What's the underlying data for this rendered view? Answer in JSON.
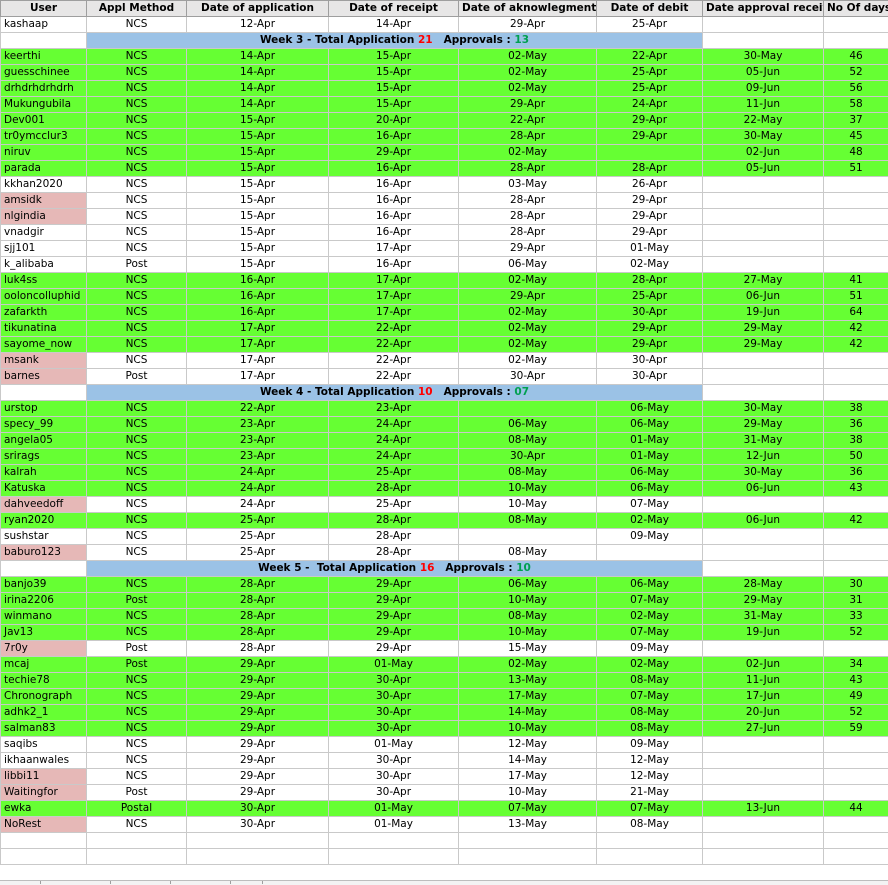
{
  "headers": [
    "User",
    "Appl Method",
    "Date of application",
    "Date of receipt",
    "Date of aknowlegment",
    "Date of debit",
    "Date approval received",
    "No Of days"
  ],
  "rows": [
    {
      "type": "row",
      "color": "white",
      "pink": false,
      "cells": [
        "kashaap",
        "NCS",
        "12-Apr",
        "14-Apr",
        "29-Apr",
        "25-Apr",
        "",
        ""
      ]
    },
    {
      "type": "week",
      "week": "Week 3 - Total Application ",
      "total": "21",
      "approvals_label": "   Approvals : ",
      "approvals": "13"
    },
    {
      "type": "row",
      "color": "green",
      "pink": false,
      "cells": [
        "keerthi",
        "NCS",
        "14-Apr",
        "15-Apr",
        "02-May",
        "22-Apr",
        "30-May",
        "46"
      ]
    },
    {
      "type": "row",
      "color": "green",
      "pink": false,
      "cells": [
        "guesschinee",
        "NCS",
        "14-Apr",
        "15-Apr",
        "02-May",
        "25-Apr",
        "05-Jun",
        "52"
      ]
    },
    {
      "type": "row",
      "color": "green",
      "pink": false,
      "cells": [
        "drhdrhdrhdrh",
        "NCS",
        "14-Apr",
        "15-Apr",
        "02-May",
        "25-Apr",
        "09-Jun",
        "56"
      ]
    },
    {
      "type": "row",
      "color": "green",
      "pink": false,
      "cells": [
        "Mukungubila",
        "NCS",
        "14-Apr",
        "15-Apr",
        "29-Apr",
        "24-Apr",
        "11-Jun",
        "58"
      ]
    },
    {
      "type": "row",
      "color": "green",
      "pink": false,
      "cells": [
        "Dev001",
        "NCS",
        "15-Apr",
        "20-Apr",
        "22-Apr",
        "29-Apr",
        "22-May",
        "37"
      ]
    },
    {
      "type": "row",
      "color": "green",
      "pink": false,
      "cells": [
        "tr0ymcclur3",
        "NCS",
        "15-Apr",
        "16-Apr",
        "28-Apr",
        "29-Apr",
        "30-May",
        "45"
      ]
    },
    {
      "type": "row",
      "color": "green",
      "pink": false,
      "cells": [
        "niruv",
        "NCS",
        "15-Apr",
        "29-Apr",
        "02-May",
        "",
        "02-Jun",
        "48"
      ]
    },
    {
      "type": "row",
      "color": "green",
      "pink": false,
      "cells": [
        "parada",
        "NCS",
        "15-Apr",
        "16-Apr",
        "28-Apr",
        "28-Apr",
        "05-Jun",
        "51"
      ]
    },
    {
      "type": "row",
      "color": "white",
      "pink": false,
      "cells": [
        "kkhan2020",
        "NCS",
        "15-Apr",
        "16-Apr",
        "03-May",
        "26-Apr",
        "",
        ""
      ]
    },
    {
      "type": "row",
      "color": "white",
      "pink": true,
      "cells": [
        "amsidk",
        "NCS",
        "15-Apr",
        "16-Apr",
        "28-Apr",
        "29-Apr",
        "",
        ""
      ]
    },
    {
      "type": "row",
      "color": "white",
      "pink": true,
      "cells": [
        "nlgindia",
        "NCS",
        "15-Apr",
        "16-Apr",
        "28-Apr",
        "29-Apr",
        "",
        ""
      ]
    },
    {
      "type": "row",
      "color": "white",
      "pink": false,
      "cells": [
        "vnadgir",
        "NCS",
        "15-Apr",
        "16-Apr",
        "28-Apr",
        "29-Apr",
        "",
        ""
      ]
    },
    {
      "type": "row",
      "color": "white",
      "pink": false,
      "cells": [
        "sjj101",
        "NCS",
        "15-Apr",
        "17-Apr",
        "29-Apr",
        "01-May",
        "",
        ""
      ]
    },
    {
      "type": "row",
      "color": "white",
      "pink": false,
      "cells": [
        "k_alibaba",
        "Post",
        "15-Apr",
        "16-Apr",
        "06-May",
        "02-May",
        "",
        ""
      ]
    },
    {
      "type": "row",
      "color": "green",
      "pink": false,
      "cells": [
        "luk4ss",
        "NCS",
        "16-Apr",
        "17-Apr",
        "02-May",
        "28-Apr",
        "27-May",
        "41"
      ]
    },
    {
      "type": "row",
      "color": "green",
      "pink": false,
      "cells": [
        "ooloncolluphid",
        "NCS",
        "16-Apr",
        "17-Apr",
        "29-Apr",
        "25-Apr",
        "06-Jun",
        "51"
      ]
    },
    {
      "type": "row",
      "color": "green",
      "pink": false,
      "cells": [
        "zafarkth",
        "NCS",
        "16-Apr",
        "17-Apr",
        "02-May",
        "30-Apr",
        "19-Jun",
        "64"
      ]
    },
    {
      "type": "row",
      "color": "green",
      "pink": false,
      "cells": [
        "tikunatina",
        "NCS",
        "17-Apr",
        "22-Apr",
        "02-May",
        "29-Apr",
        "29-May",
        "42"
      ]
    },
    {
      "type": "row",
      "color": "green",
      "pink": false,
      "cells": [
        "sayome_now",
        "NCS",
        "17-Apr",
        "22-Apr",
        "02-May",
        "29-Apr",
        "29-May",
        "42"
      ]
    },
    {
      "type": "row",
      "color": "white",
      "pink": true,
      "cells": [
        "msank",
        "NCS",
        "17-Apr",
        "22-Apr",
        "02-May",
        "30-Apr",
        "",
        ""
      ]
    },
    {
      "type": "row",
      "color": "white",
      "pink": true,
      "cells": [
        "barnes",
        "Post",
        "17-Apr",
        "22-Apr",
        "30-Apr",
        "30-Apr",
        "",
        ""
      ]
    },
    {
      "type": "week",
      "week": "Week 4 - Total Application ",
      "total": "10",
      "approvals_label": "   Approvals : ",
      "approvals": "07"
    },
    {
      "type": "row",
      "color": "green",
      "pink": false,
      "cells": [
        "urstop",
        "NCS",
        "22-Apr",
        "23-Apr",
        "",
        "06-May",
        "30-May",
        "38"
      ]
    },
    {
      "type": "row",
      "color": "green",
      "pink": false,
      "cells": [
        "specy_99",
        "NCS",
        "23-Apr",
        "24-Apr",
        "06-May",
        "06-May",
        "29-May",
        "36"
      ]
    },
    {
      "type": "row",
      "color": "green",
      "pink": false,
      "cells": [
        "angela05",
        "NCS",
        "23-Apr",
        "24-Apr",
        "08-May",
        "01-May",
        "31-May",
        "38"
      ]
    },
    {
      "type": "row",
      "color": "green",
      "pink": false,
      "cells": [
        "srirags",
        "NCS",
        "23-Apr",
        "24-Apr",
        "30-Apr",
        "01-May",
        "12-Jun",
        "50"
      ]
    },
    {
      "type": "row",
      "color": "green",
      "pink": false,
      "cells": [
        "kalrah",
        "NCS",
        "24-Apr",
        "25-Apr",
        "08-May",
        "06-May",
        "30-May",
        "36"
      ]
    },
    {
      "type": "row",
      "color": "green",
      "pink": false,
      "cells": [
        "Katuska",
        "NCS",
        "24-Apr",
        "28-Apr",
        "10-May",
        "06-May",
        "06-Jun",
        "43"
      ]
    },
    {
      "type": "row",
      "color": "white",
      "pink": true,
      "cells": [
        "dahveedoff",
        "NCS",
        "24-Apr",
        "25-Apr",
        "10-May",
        "07-May",
        "",
        ""
      ]
    },
    {
      "type": "row",
      "color": "green",
      "pink": false,
      "cells": [
        "ryan2020",
        "NCS",
        "25-Apr",
        "28-Apr",
        "08-May",
        "02-May",
        "06-Jun",
        "42"
      ]
    },
    {
      "type": "row",
      "color": "white",
      "pink": false,
      "cells": [
        "sushstar",
        "NCS",
        "25-Apr",
        "28-Apr",
        "",
        "09-May",
        "",
        ""
      ]
    },
    {
      "type": "row",
      "color": "white",
      "pink": true,
      "cells": [
        "baburo123",
        "NCS",
        "25-Apr",
        "28-Apr",
        "08-May",
        "",
        "",
        ""
      ]
    },
    {
      "type": "week",
      "week": "Week 5 -  Total Application ",
      "total": "16",
      "approvals_label": "   Approvals : ",
      "approvals": "10"
    },
    {
      "type": "row",
      "color": "green",
      "pink": false,
      "cells": [
        "banjo39",
        "NCS",
        "28-Apr",
        "29-Apr",
        "06-May",
        "06-May",
        "28-May",
        "30"
      ]
    },
    {
      "type": "row",
      "color": "green",
      "pink": false,
      "cells": [
        "irina2206",
        "Post",
        "28-Apr",
        "29-Apr",
        "10-May",
        "07-May",
        "29-May",
        "31"
      ]
    },
    {
      "type": "row",
      "color": "green",
      "pink": false,
      "cells": [
        "winmano",
        "NCS",
        "28-Apr",
        "29-Apr",
        "08-May",
        "02-May",
        "31-May",
        "33"
      ]
    },
    {
      "type": "row",
      "color": "green",
      "pink": false,
      "cells": [
        "Jav13",
        "NCS",
        "28-Apr",
        "29-Apr",
        "10-May",
        "07-May",
        "19-Jun",
        "52"
      ]
    },
    {
      "type": "row",
      "color": "white",
      "pink": true,
      "cells": [
        "7r0y",
        "Post",
        "28-Apr",
        "29-Apr",
        "15-May",
        "09-May",
        "",
        ""
      ]
    },
    {
      "type": "row",
      "color": "green",
      "pink": false,
      "cells": [
        "mcaj",
        "Post",
        "29-Apr",
        "01-May",
        "02-May",
        "02-May",
        "02-Jun",
        "34"
      ]
    },
    {
      "type": "row",
      "color": "green",
      "pink": false,
      "cells": [
        "techie78",
        "NCS",
        "29-Apr",
        "30-Apr",
        "13-May",
        "08-May",
        "11-Jun",
        "43"
      ]
    },
    {
      "type": "row",
      "color": "green",
      "pink": false,
      "cells": [
        "Chronograph",
        "NCS",
        "29-Apr",
        "30-Apr",
        "17-May",
        "07-May",
        "17-Jun",
        "49"
      ]
    },
    {
      "type": "row",
      "color": "green",
      "pink": false,
      "cells": [
        "adhk2_1",
        "NCS",
        "29-Apr",
        "30-Apr",
        "14-May",
        "08-May",
        "20-Jun",
        "52"
      ]
    },
    {
      "type": "row",
      "color": "green",
      "pink": false,
      "cells": [
        "salman83",
        "NCS",
        "29-Apr",
        "30-Apr",
        "10-May",
        "08-May",
        "27-Jun",
        "59"
      ]
    },
    {
      "type": "row",
      "color": "white",
      "pink": false,
      "cells": [
        "saqibs",
        "NCS",
        "29-Apr",
        "01-May",
        "12-May",
        "09-May",
        "",
        ""
      ]
    },
    {
      "type": "row",
      "color": "white",
      "pink": false,
      "cells": [
        "ikhaanwales",
        "NCS",
        "29-Apr",
        "30-Apr",
        "14-May",
        "12-May",
        "",
        ""
      ]
    },
    {
      "type": "row",
      "color": "white",
      "pink": true,
      "cells": [
        "libbi11",
        "NCS",
        "29-Apr",
        "30-Apr",
        "17-May",
        "12-May",
        "",
        ""
      ]
    },
    {
      "type": "row",
      "color": "white",
      "pink": true,
      "cells": [
        "Waitingfor",
        "Post",
        "29-Apr",
        "30-Apr",
        "10-May",
        "21-May",
        "",
        ""
      ]
    },
    {
      "type": "row",
      "color": "green",
      "pink": false,
      "cells": [
        "ewka",
        "Postal",
        "30-Apr",
        "01-May",
        "07-May",
        "07-May",
        "13-Jun",
        "44"
      ]
    },
    {
      "type": "row",
      "color": "white",
      "pink": true,
      "cells": [
        "NoRest",
        "NCS",
        "30-Apr",
        "01-May",
        "13-May",
        "08-May",
        "",
        ""
      ]
    }
  ],
  "colors": {
    "green": "#66ff33",
    "pink": "#e6b8b7",
    "week_blue": "#9bc2e6",
    "header_gray": "#e7e6e6",
    "red": "#ff0000",
    "teal": "#00a050"
  }
}
